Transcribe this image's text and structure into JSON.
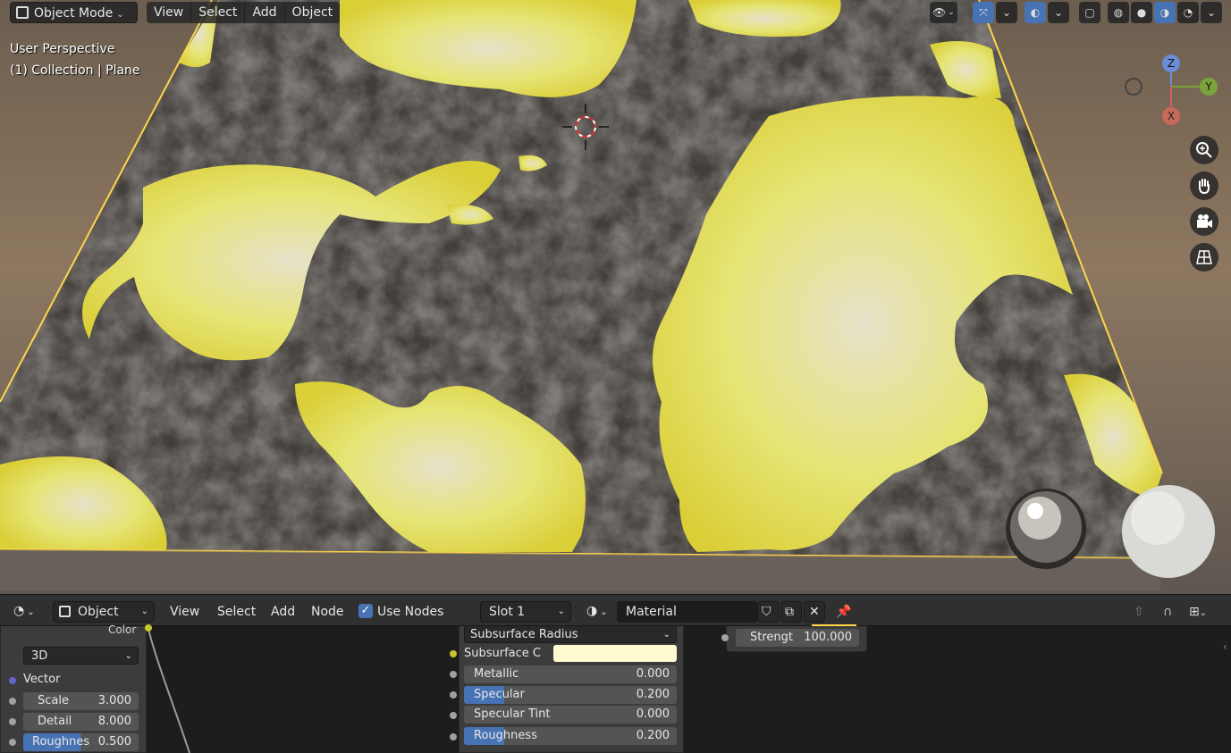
{
  "viewport": {
    "mode": "Object Mode",
    "menus": [
      "View",
      "Select",
      "Add",
      "Object"
    ],
    "info_line1": "User Perspective",
    "info_line2": "(1) Collection | Plane",
    "gizmo": {
      "z": "Z",
      "y": "Y",
      "x": "X"
    },
    "colors": {
      "lava": "#ffff66",
      "rock": "#4a4642",
      "selection_outline": "#ffd54a"
    }
  },
  "node_editor": {
    "editor_type": "Object",
    "menus": [
      "View",
      "Select",
      "Add",
      "Node"
    ],
    "use_nodes_label": "Use Nodes",
    "use_nodes_checked": true,
    "slot": "Slot 1",
    "material": "Material",
    "noise_node": {
      "color_label": "Color",
      "dimension": "3D",
      "vector_label": "Vector",
      "fields": [
        {
          "label": "Scale",
          "value": "3.000"
        },
        {
          "label": "Detail",
          "value": "8.000"
        },
        {
          "label": "Roughnes",
          "value": "0.500"
        }
      ]
    },
    "bsdf_node": {
      "subsurface_method": "Subsurface Radius",
      "subsurface_color_label": "Subsurface C",
      "fields": [
        {
          "label": "Metallic",
          "value": "0.000"
        },
        {
          "label": "Specular",
          "value": "0.200"
        },
        {
          "label": "Specular Tint",
          "value": "0.000"
        },
        {
          "label": "Roughness",
          "value": "0.200"
        }
      ]
    },
    "emission_node": {
      "strength_label": "Strengt",
      "strength_value": "100.000"
    }
  }
}
